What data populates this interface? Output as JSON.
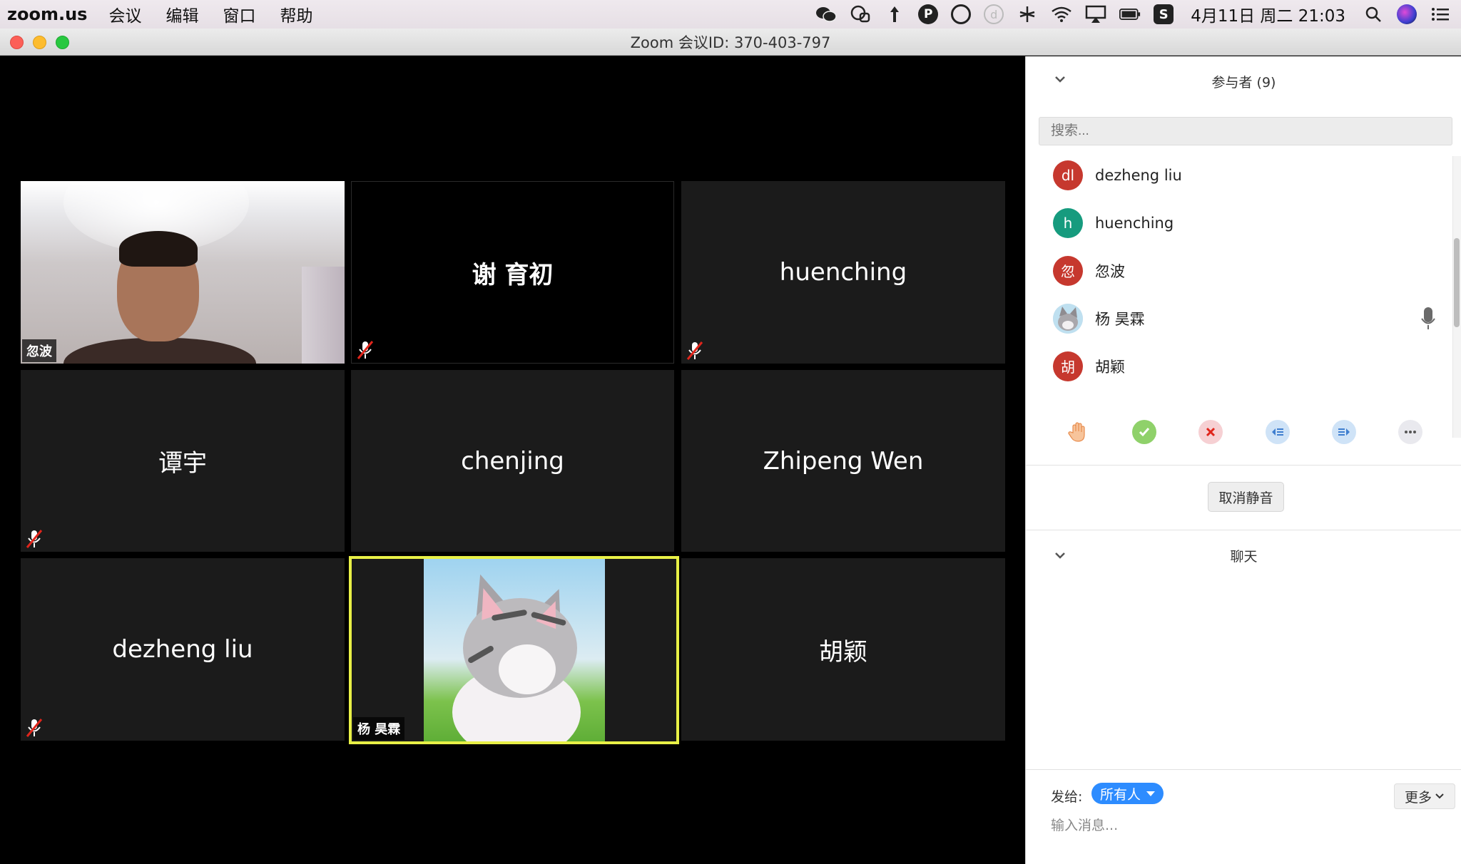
{
  "menubar": {
    "app_name": "zoom.us",
    "menus": [
      "会议",
      "编辑",
      "窗口",
      "帮助"
    ],
    "clock": "4月11日 周二  21:03",
    "tray_icons": [
      "wechat-icon",
      "chat-bubbles-icon",
      "upload-arrow-icon",
      "p-circle-icon",
      "shield-circle-icon",
      "d-circle-icon",
      "scissors-icon",
      "wifi-icon",
      "airplay-icon",
      "battery-icon",
      "s-app-icon",
      "spotlight-search-icon",
      "siri-icon",
      "notification-list-icon"
    ]
  },
  "window": {
    "title": "Zoom 会议ID: 370-403-797"
  },
  "video": {
    "tiles": [
      {
        "name": "忽波",
        "type": "camera",
        "muted": false
      },
      {
        "name": "谢 育初",
        "type": "name",
        "muted": true
      },
      {
        "name": "huenching",
        "type": "name",
        "muted": true
      },
      {
        "name": "谭宇",
        "type": "name",
        "muted": true
      },
      {
        "name": "chenjing",
        "type": "name",
        "muted": false
      },
      {
        "name": "Zhipeng Wen",
        "type": "name",
        "muted": false
      },
      {
        "name": "dezheng liu",
        "type": "name",
        "muted": true
      },
      {
        "name": "杨 昊霖",
        "type": "avatar-image",
        "muted": false,
        "active_speaker": true
      },
      {
        "name": "胡颖",
        "type": "name",
        "muted": false
      }
    ]
  },
  "participants": {
    "header": "参与者 (9)",
    "search_placeholder": "搜索...",
    "list": [
      {
        "initials": "dl",
        "name": "dezheng liu",
        "color": "#c6382e"
      },
      {
        "initials": "h",
        "name": "huenching",
        "color": "#169b7e"
      },
      {
        "initials": "忽",
        "name": "忽波",
        "color": "#c6382e"
      },
      {
        "initials": "",
        "name": "杨 昊霖",
        "color": "#cfd8e2"
      },
      {
        "initials": "胡",
        "name": "胡颖",
        "color": "#c6382e"
      }
    ],
    "actions": [
      "raise-hand",
      "yes",
      "no",
      "slower",
      "faster",
      "more"
    ],
    "unmute_label": "取消静音"
  },
  "chat": {
    "header": "聊天",
    "send_to_label": "发给:",
    "recipient": "所有人",
    "more_label": "更多",
    "input_placeholder": "输入消息..."
  },
  "colors": {
    "active_speaker_border": "#e8f046",
    "recipient_pill": "#2d8cff",
    "muted_red": "#e0251b"
  }
}
